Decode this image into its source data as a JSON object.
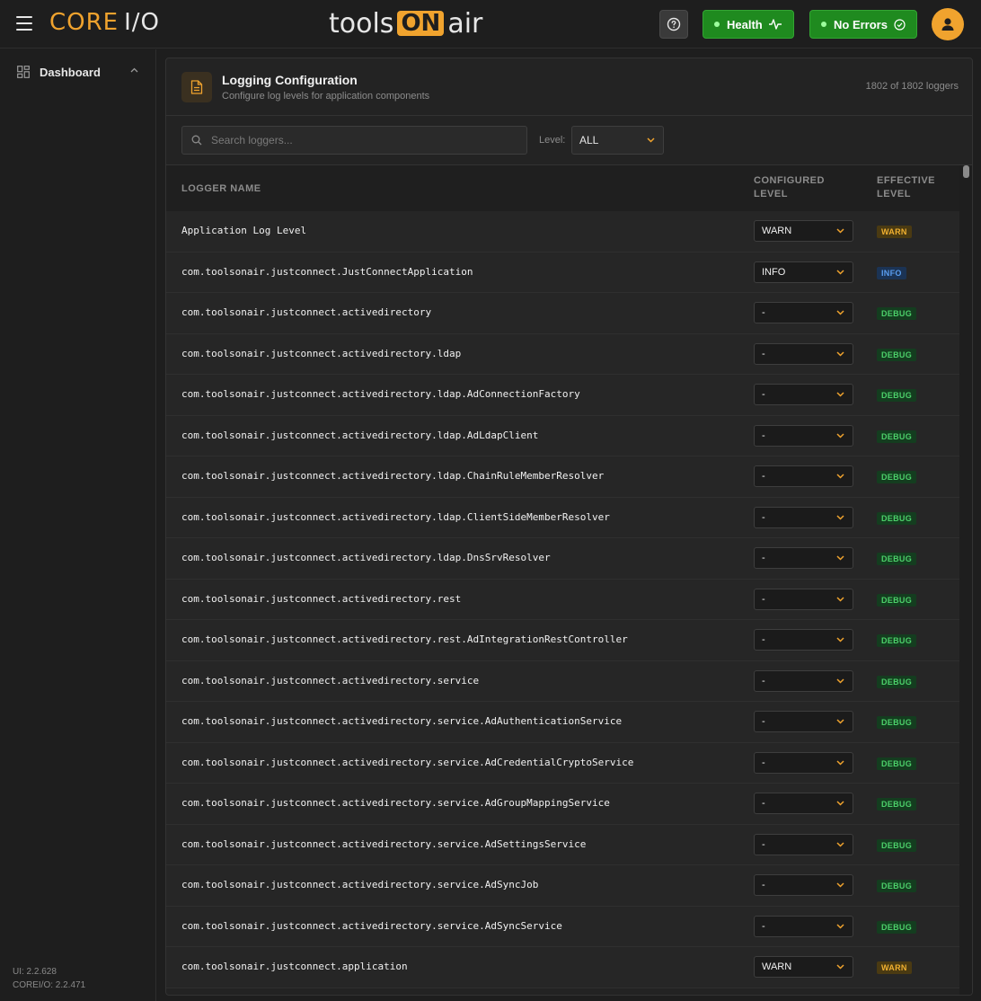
{
  "topbar": {
    "logo_core": "CORE",
    "logo_io": "I/O",
    "brand_left": "tools",
    "brand_on": "ON",
    "brand_right": "air",
    "health_label": "Health",
    "errors_label": "No Errors"
  },
  "sidebar": {
    "items": [
      {
        "label": "Dashboard",
        "icon": "dashboard-icon"
      }
    ],
    "ui_version": "UI: 2.2.628",
    "core_version": "COREI/O: 2.2.471"
  },
  "panel": {
    "title": "Logging Configuration",
    "subtitle": "Configure log levels for application components",
    "count": "1802 of 1802 loggers"
  },
  "filters": {
    "search_placeholder": "Search loggers...",
    "level_label": "Level:",
    "level_value": "ALL"
  },
  "table": {
    "headers": {
      "name": "LOGGER NAME",
      "configured": "CONFIGURED LEVEL",
      "effective": "EFFECTIVE LEVEL"
    },
    "rows": [
      {
        "name": "Application Log Level",
        "configured": "WARN",
        "effective": "WARN"
      },
      {
        "name": "com.toolsonair.justconnect.JustConnectApplication",
        "configured": "INFO",
        "effective": "INFO"
      },
      {
        "name": "com.toolsonair.justconnect.activedirectory",
        "configured": "-",
        "effective": "DEBUG"
      },
      {
        "name": "com.toolsonair.justconnect.activedirectory.ldap",
        "configured": "-",
        "effective": "DEBUG"
      },
      {
        "name": "com.toolsonair.justconnect.activedirectory.ldap.AdConnectionFactory",
        "configured": "-",
        "effective": "DEBUG"
      },
      {
        "name": "com.toolsonair.justconnect.activedirectory.ldap.AdLdapClient",
        "configured": "-",
        "effective": "DEBUG"
      },
      {
        "name": "com.toolsonair.justconnect.activedirectory.ldap.ChainRuleMemberResolver",
        "configured": "-",
        "effective": "DEBUG"
      },
      {
        "name": "com.toolsonair.justconnect.activedirectory.ldap.ClientSideMemberResolver",
        "configured": "-",
        "effective": "DEBUG"
      },
      {
        "name": "com.toolsonair.justconnect.activedirectory.ldap.DnsSrvResolver",
        "configured": "-",
        "effective": "DEBUG"
      },
      {
        "name": "com.toolsonair.justconnect.activedirectory.rest",
        "configured": "-",
        "effective": "DEBUG"
      },
      {
        "name": "com.toolsonair.justconnect.activedirectory.rest.AdIntegrationRestController",
        "configured": "-",
        "effective": "DEBUG"
      },
      {
        "name": "com.toolsonair.justconnect.activedirectory.service",
        "configured": "-",
        "effective": "DEBUG"
      },
      {
        "name": "com.toolsonair.justconnect.activedirectory.service.AdAuthenticationService",
        "configured": "-",
        "effective": "DEBUG"
      },
      {
        "name": "com.toolsonair.justconnect.activedirectory.service.AdCredentialCryptoService",
        "configured": "-",
        "effective": "DEBUG"
      },
      {
        "name": "com.toolsonair.justconnect.activedirectory.service.AdGroupMappingService",
        "configured": "-",
        "effective": "DEBUG"
      },
      {
        "name": "com.toolsonair.justconnect.activedirectory.service.AdSettingsService",
        "configured": "-",
        "effective": "DEBUG"
      },
      {
        "name": "com.toolsonair.justconnect.activedirectory.service.AdSyncJob",
        "configured": "-",
        "effective": "DEBUG"
      },
      {
        "name": "com.toolsonair.justconnect.activedirectory.service.AdSyncService",
        "configured": "-",
        "effective": "DEBUG"
      },
      {
        "name": "com.toolsonair.justconnect.application",
        "configured": "WARN",
        "effective": "WARN"
      }
    ]
  },
  "colors": {
    "accent": "#f0a32e",
    "health_green": "#1f8a1f",
    "warn": "#f0b030",
    "info": "#5a9ef0",
    "debug": "#4cd06a"
  }
}
